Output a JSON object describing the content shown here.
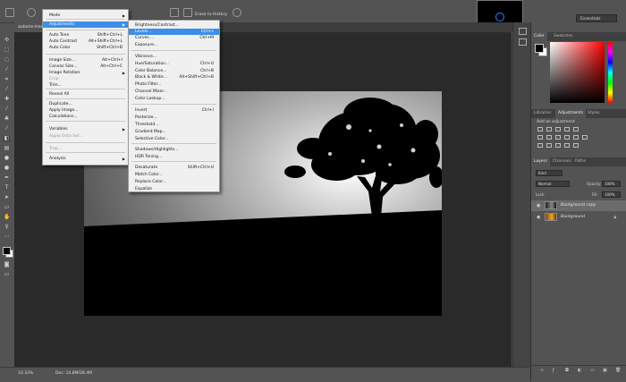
{
  "app": {
    "doc_tab": "autumn-tree",
    "zoom": "33.33%",
    "doc_size": "Doc: 14.8M/28.4M"
  },
  "options_bar": {
    "erase_to_history": "Erase to History",
    "workspace": "Essentials"
  },
  "image_menu": {
    "items": [
      {
        "label": "Mode",
        "shortcut": "",
        "arrow": true,
        "disabled": false,
        "highlight": false
      },
      {
        "label": "Adjustments",
        "shortcut": "",
        "arrow": true,
        "disabled": false,
        "highlight": true
      },
      {
        "label": "Auto Tone",
        "shortcut": "Shift+Ctrl+L",
        "arrow": false,
        "disabled": false,
        "highlight": false
      },
      {
        "label": "Auto Contrast",
        "shortcut": "Alt+Shift+Ctrl+L",
        "arrow": false,
        "disabled": false,
        "highlight": false
      },
      {
        "label": "Auto Color",
        "shortcut": "Shift+Ctrl+B",
        "arrow": false,
        "disabled": false,
        "highlight": false
      },
      {
        "label": "Image Size...",
        "shortcut": "Alt+Ctrl+I",
        "arrow": false,
        "disabled": false,
        "highlight": false
      },
      {
        "label": "Canvas Size...",
        "shortcut": "Alt+Ctrl+C",
        "arrow": false,
        "disabled": false,
        "highlight": false
      },
      {
        "label": "Image Rotation",
        "shortcut": "",
        "arrow": true,
        "disabled": false,
        "highlight": false
      },
      {
        "label": "Crop",
        "shortcut": "",
        "arrow": false,
        "disabled": true,
        "highlight": false
      },
      {
        "label": "Trim...",
        "shortcut": "",
        "arrow": false,
        "disabled": false,
        "highlight": false
      },
      {
        "label": "Reveal All",
        "shortcut": "",
        "arrow": false,
        "disabled": false,
        "highlight": false
      },
      {
        "label": "Duplicate...",
        "shortcut": "",
        "arrow": false,
        "disabled": false,
        "highlight": false
      },
      {
        "label": "Apply Image...",
        "shortcut": "",
        "arrow": false,
        "disabled": false,
        "highlight": false
      },
      {
        "label": "Calculations...",
        "shortcut": "",
        "arrow": false,
        "disabled": false,
        "highlight": false
      },
      {
        "label": "Variables",
        "shortcut": "",
        "arrow": true,
        "disabled": false,
        "highlight": false
      },
      {
        "label": "Apply Data Set...",
        "shortcut": "",
        "arrow": false,
        "disabled": true,
        "highlight": false
      },
      {
        "label": "Trap...",
        "shortcut": "",
        "arrow": false,
        "disabled": true,
        "highlight": false
      },
      {
        "label": "Analysis",
        "shortcut": "",
        "arrow": true,
        "disabled": false,
        "highlight": false
      }
    ]
  },
  "adjustments_menu": {
    "items": [
      {
        "label": "Brightness/Contrast...",
        "shortcut": "",
        "highlight": false
      },
      {
        "label": "Levels...",
        "shortcut": "Ctrl+L",
        "highlight": true
      },
      {
        "label": "Curves...",
        "shortcut": "Ctrl+M",
        "highlight": false
      },
      {
        "label": "Exposure...",
        "shortcut": "",
        "highlight": false
      },
      {
        "label": "Vibrance...",
        "shortcut": "",
        "highlight": false
      },
      {
        "label": "Hue/Saturation...",
        "shortcut": "Ctrl+U",
        "highlight": false
      },
      {
        "label": "Color Balance...",
        "shortcut": "Ctrl+B",
        "highlight": false
      },
      {
        "label": "Black & White...",
        "shortcut": "Alt+Shift+Ctrl+B",
        "highlight": false
      },
      {
        "label": "Photo Filter...",
        "shortcut": "",
        "highlight": false
      },
      {
        "label": "Channel Mixer...",
        "shortcut": "",
        "highlight": false
      },
      {
        "label": "Color Lookup...",
        "shortcut": "",
        "highlight": false
      },
      {
        "label": "Invert",
        "shortcut": "Ctrl+I",
        "highlight": false
      },
      {
        "label": "Posterize...",
        "shortcut": "",
        "highlight": false
      },
      {
        "label": "Threshold...",
        "shortcut": "",
        "highlight": false
      },
      {
        "label": "Gradient Map...",
        "shortcut": "",
        "highlight": false
      },
      {
        "label": "Selective Color...",
        "shortcut": "",
        "highlight": false
      },
      {
        "label": "Shadows/Highlights...",
        "shortcut": "",
        "highlight": false
      },
      {
        "label": "HDR Toning...",
        "shortcut": "",
        "highlight": false
      },
      {
        "label": "Desaturate",
        "shortcut": "Shift+Ctrl+U",
        "highlight": false
      },
      {
        "label": "Match Color...",
        "shortcut": "",
        "highlight": false
      },
      {
        "label": "Replace Color...",
        "shortcut": "",
        "highlight": false
      },
      {
        "label": "Equalize",
        "shortcut": "",
        "highlight": false
      }
    ]
  },
  "color_panel": {
    "tabs": [
      "Color",
      "Swatches"
    ],
    "fg": "#000000",
    "bg": "#ffffff"
  },
  "adjustments_panel": {
    "tabs": [
      "Libraries",
      "Adjustments",
      "Styles"
    ],
    "add_label": "Add an adjustment"
  },
  "layers_panel": {
    "tabs": [
      "Layers",
      "Channels",
      "Paths"
    ],
    "kind": "Kind",
    "blend_mode": "Normal",
    "opacity_label": "Opacity:",
    "opacity": "100%",
    "lock_label": "Lock:",
    "fill_label": "Fill:",
    "fill": "100%",
    "layers": [
      {
        "name": "Background copy",
        "selected": true
      },
      {
        "name": "Background",
        "selected": false
      }
    ]
  },
  "colors": {
    "accent": "#3d8ee8",
    "panel": "#535353",
    "pasteboard": "#2a2a2a"
  }
}
